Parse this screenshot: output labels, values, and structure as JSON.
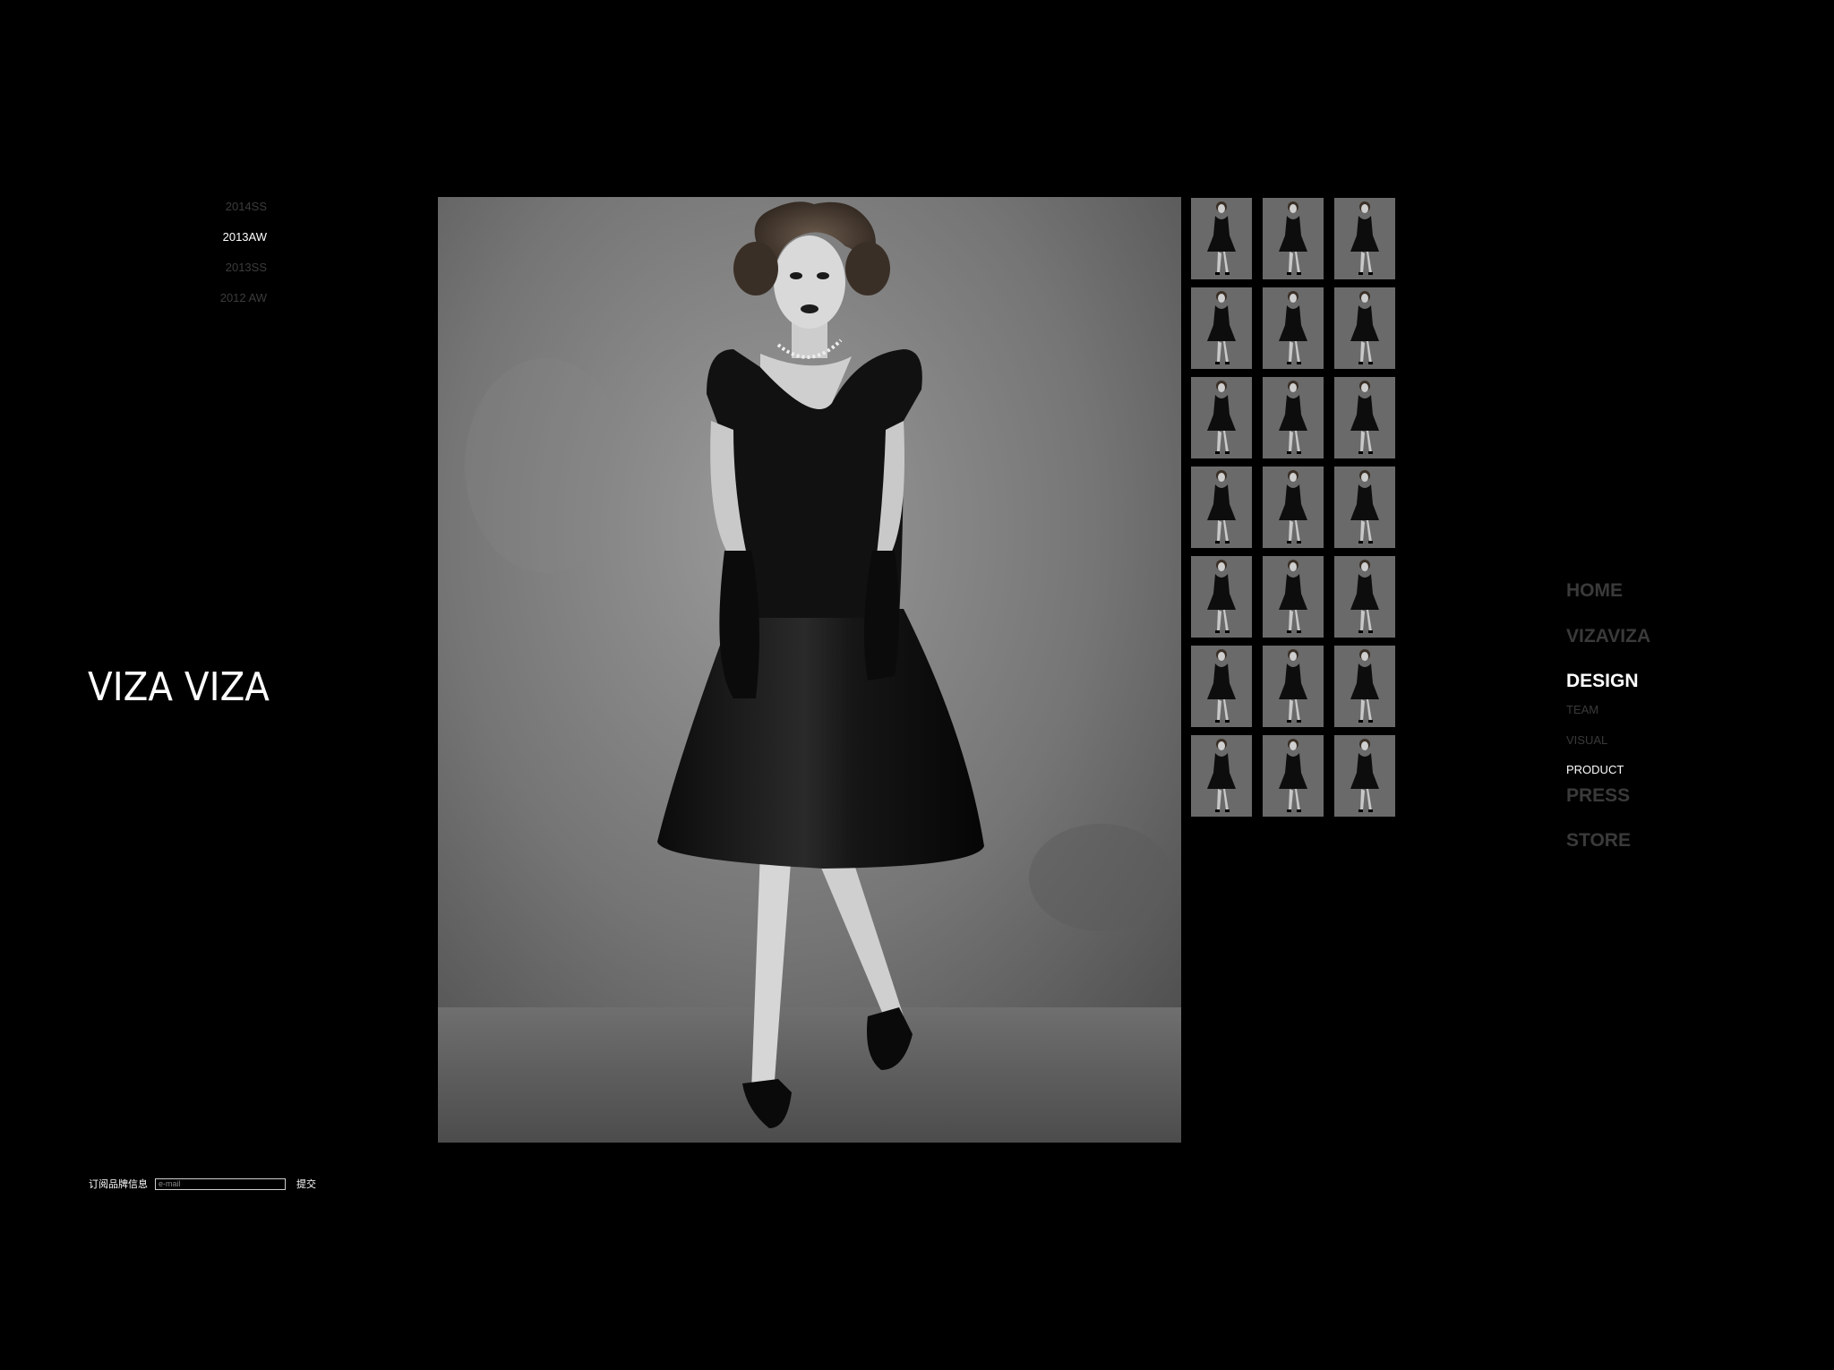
{
  "seasons": [
    {
      "label": "2014SS",
      "active": false
    },
    {
      "label": "2013AW",
      "active": true
    },
    {
      "label": "2013SS",
      "active": false
    },
    {
      "label": "2012 AW",
      "active": false
    }
  ],
  "logo": {
    "text": "VIZA VIZA"
  },
  "subscribe": {
    "label": "订阅品牌信息",
    "placeholder": "e-mail",
    "submit": "提交"
  },
  "main_photo": {
    "icon": "model-in-black-dress-photo"
  },
  "thumbnails": {
    "rows": 7,
    "columns": 3,
    "icon": "model-thumbnail"
  },
  "nav": {
    "home": "HOME",
    "vizaviza": "VIZAVIZA",
    "design": "DESIGN",
    "team": "TEAM",
    "visual": "VISUAL",
    "product": "PRODUCT",
    "press": "PRESS",
    "store": "STORE"
  },
  "colors": {
    "background": "#000000",
    "active_text": "#ffffff",
    "inactive_text": "#3c3c3c"
  }
}
